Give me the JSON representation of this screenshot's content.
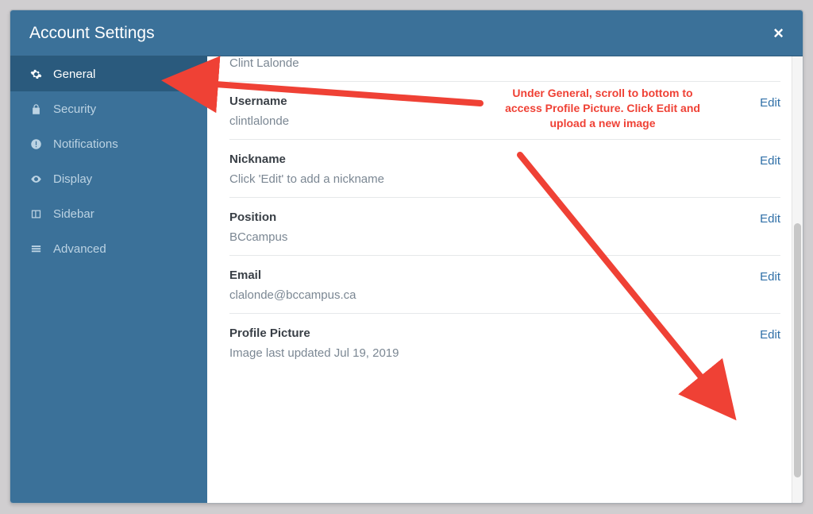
{
  "modal": {
    "title": "Account Settings",
    "close_label": "×"
  },
  "sidebar": {
    "items": [
      {
        "label": "General"
      },
      {
        "label": "Security"
      },
      {
        "label": "Notifications"
      },
      {
        "label": "Display"
      },
      {
        "label": "Sidebar"
      },
      {
        "label": "Advanced"
      }
    ]
  },
  "content": {
    "truncated_top_value": "Clint Lalonde",
    "sections": [
      {
        "label": "Username",
        "value": "clintlalonde"
      },
      {
        "label": "Nickname",
        "value": "Click 'Edit' to add a nickname"
      },
      {
        "label": "Position",
        "value": "BCcampus"
      },
      {
        "label": "Email",
        "value": "clalonde@bccampus.ca"
      },
      {
        "label": "Profile Picture",
        "value": "Image last updated Jul 19, 2019"
      }
    ],
    "edit_label": "Edit"
  },
  "annotation": {
    "text": "Under General, scroll to bottom to access Profile Picture. Click Edit and upload a new image"
  }
}
